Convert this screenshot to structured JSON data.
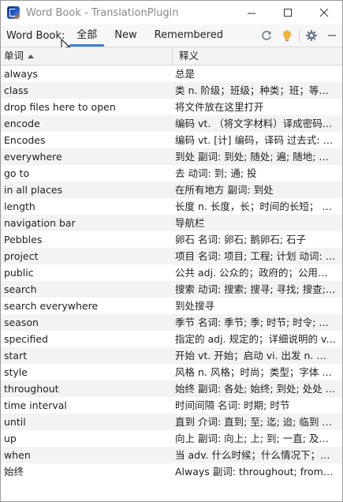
{
  "window": {
    "title": "Word Book - TranslationPlugin"
  },
  "toolbar": {
    "label": "Word Book:",
    "tabs": [
      {
        "label": "全部",
        "active": true
      },
      {
        "label": "New",
        "active": false
      },
      {
        "label": "Remembered",
        "active": false
      }
    ],
    "icons": [
      "refresh-icon",
      "lightbulb-icon",
      "gear-icon",
      "minimize-panel-icon"
    ]
  },
  "table": {
    "columns": {
      "word": "单词",
      "definition": "释义"
    },
    "rows": [
      {
        "word": "always",
        "definition": "总是"
      },
      {
        "word": "class",
        "definition": "类 n. 阶级；班级；种类；班；等级 v..."
      },
      {
        "word": "drop files here to open",
        "definition": "将文件放在这里打开"
      },
      {
        "word": "encode",
        "definition": "编码 vt. （将文字材料）译成密码；..."
      },
      {
        "word": "Encodes",
        "definition": "编码 vt. [计] 编码，译码 过去式: en..."
      },
      {
        "word": "everywhere",
        "definition": "到处 副词: 到处; 随处; 遍; 随地; 普; ..."
      },
      {
        "word": "go to",
        "definition": "去 动词: 到; 通; 投"
      },
      {
        "word": "in all places",
        "definition": "在所有地方 副词: 到处"
      },
      {
        "word": "length",
        "definition": "长度 n. 长度，长；时间的长短； （..."
      },
      {
        "word": "navigation bar",
        "definition": "导航栏"
      },
      {
        "word": "Pebbles",
        "definition": "卵石 名词: 卵石; 鹅卵石; 石子"
      },
      {
        "word": "project",
        "definition": "项目 名词: 项目; 工程; 计划 动词: 投..."
      },
      {
        "word": "public",
        "definition": "公共 adj. 公众的；政府的；公用的；..."
      },
      {
        "word": "search",
        "definition": "搜索 动词: 搜索; 搜寻; 寻找; 搜查; 搜..."
      },
      {
        "word": "search everywhere",
        "definition": "到处搜寻"
      },
      {
        "word": "season",
        "definition": "季节 名词: 季节; 季; 时节; 时令; 令; ..."
      },
      {
        "word": "specified",
        "definition": "指定的 adj. 规定的；详细说明的 v. ..."
      },
      {
        "word": "start",
        "definition": "开始 vt. 开始；启动 vi. 出发 n. 开始..."
      },
      {
        "word": "style",
        "definition": "风格 n. 风格；时尚；类型；字体 vt. ..."
      },
      {
        "word": "throughout",
        "definition": "始终 副词: 各处; 始终; 到处; 处处 介..."
      },
      {
        "word": "time interval",
        "definition": "时间间隔 名词: 时期; 时节"
      },
      {
        "word": "until",
        "definition": "直到 介词: 直到; 至; 迄; 迨; 临到 连..."
      },
      {
        "word": "up",
        "definition": "向上 副词: 向上; 上; 到; 一直; 及至; ..."
      },
      {
        "word": "when",
        "definition": "当 adv. 什么时候；什么情况下；什..."
      },
      {
        "word": "始终",
        "definition": "Always 副词: throughout; from be..."
      }
    ]
  },
  "colors": {
    "tab_underline": "#3d7fce",
    "refresh_icon": "#6b7a8a",
    "lightbulb_icon": "#f2b134",
    "row_stripe": "#f2f3f5"
  }
}
